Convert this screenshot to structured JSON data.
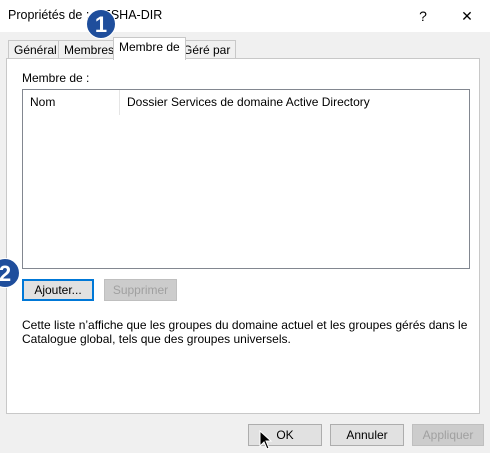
{
  "window": {
    "title": "Propriétés de : GESHA-DIR",
    "help_glyph": "?",
    "close_glyph": "✕"
  },
  "tabs": [
    {
      "label": "Général"
    },
    {
      "label": "Membres"
    },
    {
      "label": "Membre de"
    },
    {
      "label": "Géré par"
    }
  ],
  "member_of": {
    "label": "Membre de :",
    "columns": [
      "Nom",
      "Dossier Services de domaine Active Directory"
    ],
    "add_label": "Ajouter...",
    "remove_label": "Supprimer",
    "info_text": "Cette liste n’affiche que les groupes du domaine actuel et les groupes gérés dans le Catalogue global, tels que des groupes universels."
  },
  "footer": {
    "ok_label": "OK",
    "cancel_label": "Annuler",
    "apply_label": "Appliquer"
  },
  "badges": [
    "1",
    "2"
  ],
  "colors": {
    "badge": "#1f4e9c",
    "accent": "#0078d7"
  }
}
